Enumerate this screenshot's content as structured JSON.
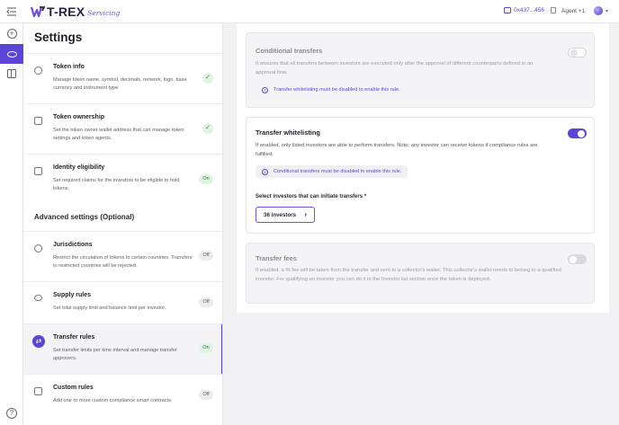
{
  "topbar": {
    "brand": "T-REX",
    "brand_sub": "Servicing",
    "wallet": "0x437...456",
    "agent": "Agent +1"
  },
  "settings": {
    "title": "Settings",
    "items": [
      {
        "title": "Token info",
        "desc": "Manage token name, symbol, decimals, network, logo, base currency and instrument type.",
        "status": "check"
      },
      {
        "title": "Token ownership",
        "desc": "Set the token owner wallet address that can manage token settings and token agents.",
        "status": "check"
      },
      {
        "title": "Identity eligibility",
        "desc": "Set required claims for the investors to be eligible to hold tokens.",
        "status": "On"
      }
    ],
    "advanced_heading": "Advanced settings (Optional)",
    "advanced": [
      {
        "title": "Jurisdictions",
        "desc": "Restrict the circulation of tokens to certain countries. Transfers to restricted countries will be rejected.",
        "status": "Off"
      },
      {
        "title": "Supply rules",
        "desc": "Set total supply limit and balance limit per investor.",
        "status": "Off"
      },
      {
        "title": "Transfer rules",
        "desc": "Set transfer limits per time interval and manage transfer approvers.",
        "status": "On"
      },
      {
        "title": "Custom rules",
        "desc": "Add one or more custom compliance smart contracts.",
        "status": "Off"
      }
    ]
  },
  "main": {
    "conditional": {
      "title": "Conditional transfers",
      "desc": "It ensures that all transfers between investors are executed only after the approval of different counterparts defined in an approval flow.",
      "info": "Transfer whitelisting must be disabled to enable this rule.",
      "enabled": false
    },
    "whitelisting": {
      "title": "Transfer whitelisting",
      "desc": "If enabled, only listed investors are able to perform transfers. Note: any investor can receive tokens if compliance rules are fulfilled.",
      "info": "Conditional transfers must be disabled to enable this rule.",
      "field_label": "Select investors that can initiate transfers *",
      "button": "36 investors",
      "enabled": true
    },
    "fees": {
      "title": "Transfer fees",
      "desc": "If enabled, a % fee will be taken from the transfer and sent to a collector's wallet. This collector's wallet needs to belong to a qualified investor. For qualifying an investor you can do it in the Investor list section once the token is deployed.",
      "enabled": false
    }
  },
  "colors": {
    "accent": "#5b45d6",
    "on_badge": "#e1f3e3"
  }
}
